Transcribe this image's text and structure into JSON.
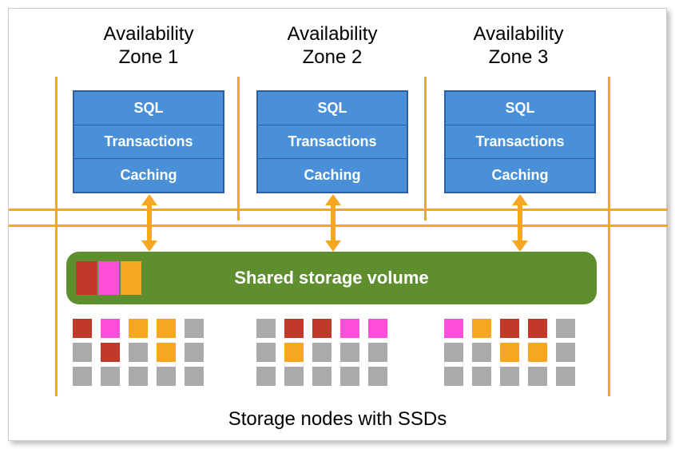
{
  "zones": [
    {
      "title": "Availability\nZone 1"
    },
    {
      "title": "Availability\nZone 2"
    },
    {
      "title": "Availability\nZone 3"
    }
  ],
  "layers": {
    "sql": "SQL",
    "transactions": "Transactions",
    "caching": "Caching"
  },
  "storage": {
    "label": "Shared storage volume",
    "header_blocks": [
      "red",
      "pink",
      "yellow"
    ]
  },
  "node_groups": [
    {
      "rows": [
        [
          "red",
          "pink",
          "yellow",
          "yellow",
          "gray"
        ],
        [
          "gray",
          "red",
          "gray",
          "yellow",
          "gray"
        ],
        [
          "gray",
          "gray",
          "gray",
          "gray",
          "gray"
        ]
      ]
    },
    {
      "rows": [
        [
          "gray",
          "red",
          "red",
          "pink",
          "pink"
        ],
        [
          "gray",
          "yellow",
          "gray",
          "gray",
          "gray"
        ],
        [
          "gray",
          "gray",
          "gray",
          "gray",
          "gray"
        ]
      ]
    },
    {
      "rows": [
        [
          "pink",
          "yellow",
          "red",
          "red",
          "gray"
        ],
        [
          "gray",
          "gray",
          "yellow",
          "yellow",
          "gray"
        ],
        [
          "gray",
          "gray",
          "gray",
          "gray",
          "gray"
        ]
      ]
    }
  ],
  "footer": "Storage nodes with SSDs",
  "colors": {
    "orange": "#f5a623",
    "blue": "#4a90d9",
    "blue_border": "#2a5fa5",
    "green": "#5e8e2e",
    "red": "#c0392b",
    "pink": "#ff4fd8",
    "yellow": "#f5a623",
    "gray": "#aaaaaa"
  }
}
